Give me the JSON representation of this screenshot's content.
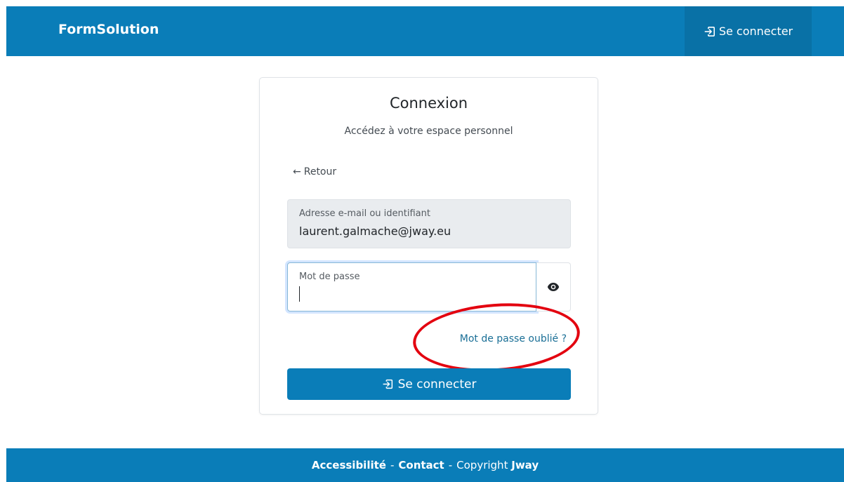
{
  "header": {
    "brand": "FormSolution",
    "login_label": "Se connecter"
  },
  "card": {
    "title": "Connexion",
    "subtitle": "Accédez à votre espace personnel",
    "back_label": "Retour",
    "email": {
      "label": "Adresse e-mail ou identifiant",
      "value": "laurent.galmache@jway.eu"
    },
    "password": {
      "label": "Mot de passe",
      "value": ""
    },
    "forgot_label": "Mot de passe oublié ?",
    "submit_label": "Se connecter"
  },
  "footer": {
    "accessibility": "Accessibilité",
    "sep1": "-",
    "contact": "Contact",
    "sep2": "-",
    "copyright_prefix": "Copyright",
    "copyright_owner": "Jway"
  },
  "colors": {
    "primary": "#0a7db8",
    "header_login_bg": "#0971a6",
    "link": "#1a6f96",
    "annotation_ring": "#e3000f"
  }
}
